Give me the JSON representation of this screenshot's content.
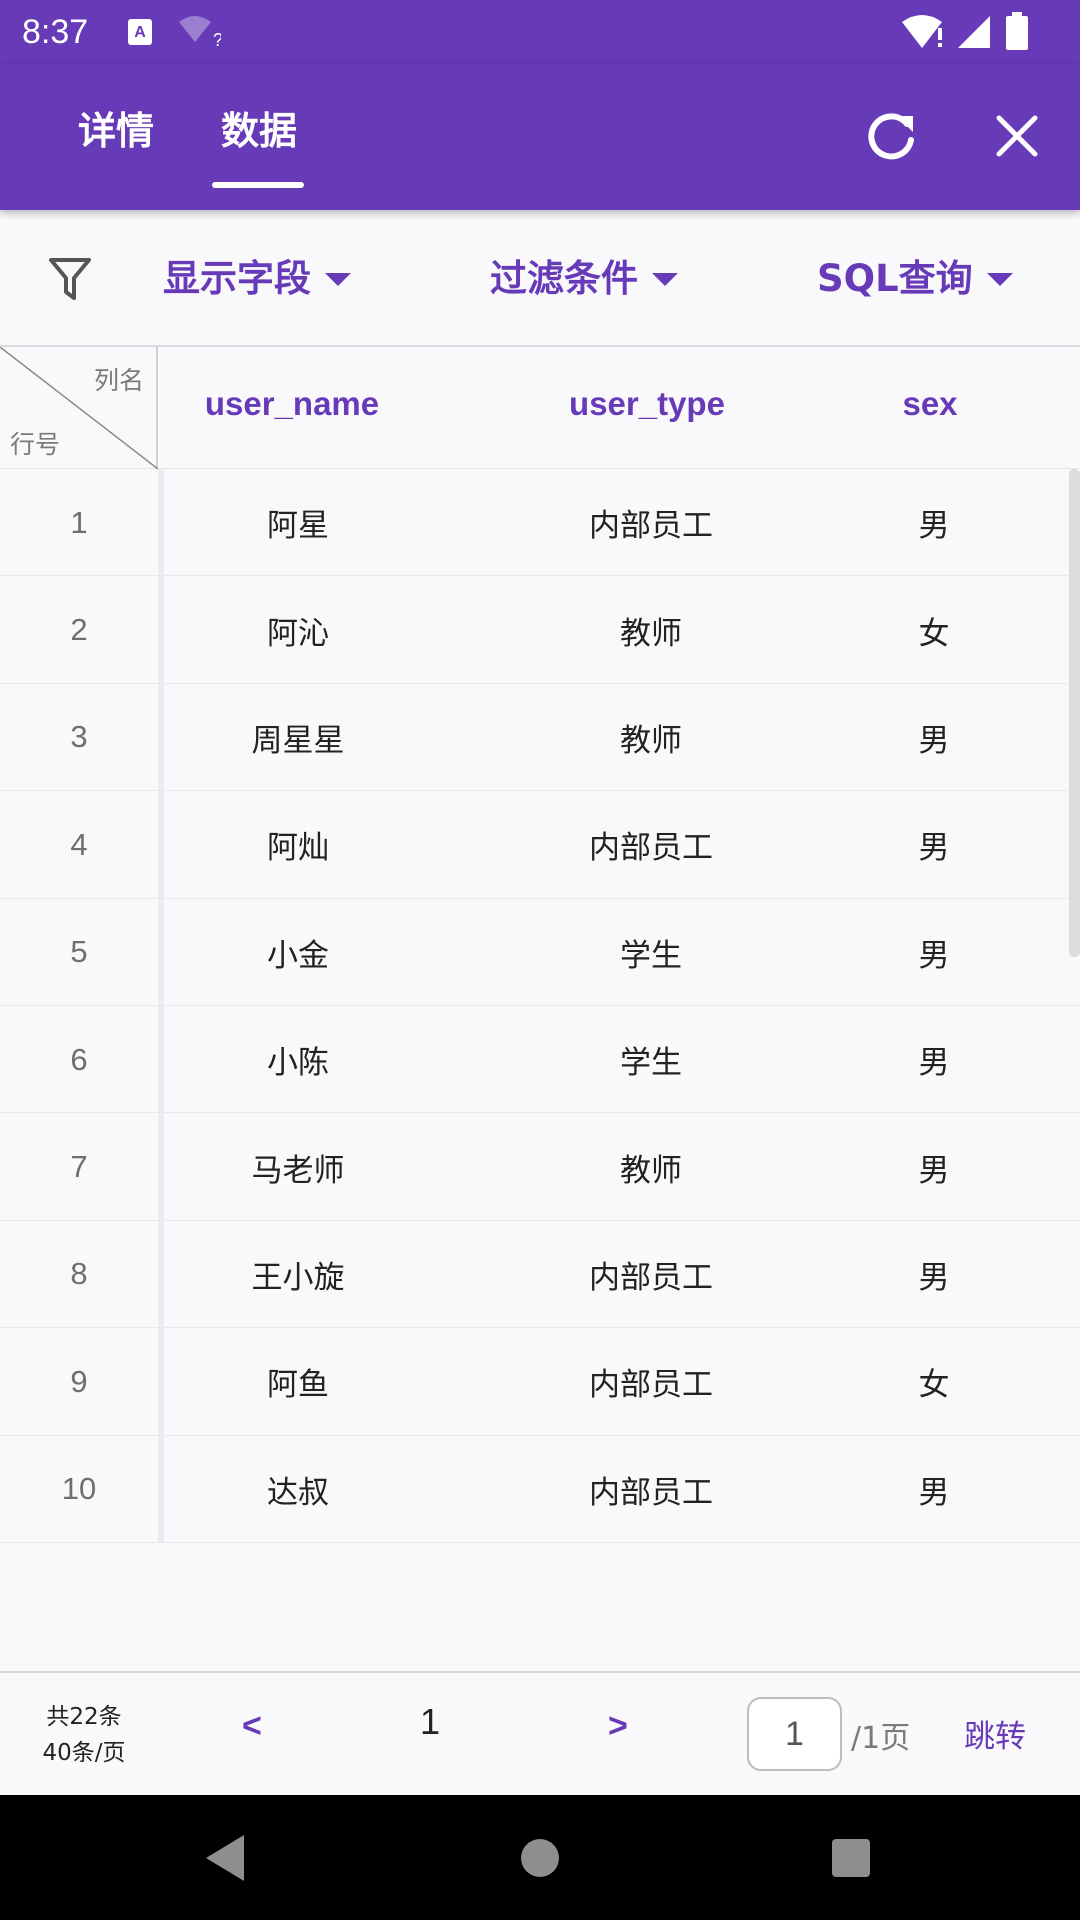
{
  "status_bar": {
    "time": "8:37",
    "icons": [
      "text-a-icon",
      "wifi-question-icon",
      "wifi-alert-icon",
      "signal-icon",
      "battery-icon"
    ]
  },
  "app_bar": {
    "tabs": [
      {
        "label": "详情",
        "selected": false
      },
      {
        "label": "数据",
        "selected": true
      }
    ],
    "actions": [
      "refresh-icon",
      "close-icon"
    ],
    "color": "#673ab7"
  },
  "toolbar": {
    "icon": "filter-icon",
    "fields_label": "显示字段",
    "filter_label": "过滤条件",
    "sql_label": "SQL查询"
  },
  "table": {
    "corner_col_label": "列名",
    "corner_row_label": "行号",
    "columns": [
      "user_name",
      "user_type",
      "sex"
    ],
    "rows": [
      {
        "idx": "1",
        "user_name": "阿星",
        "user_type": "内部员工",
        "sex": "男"
      },
      {
        "idx": "2",
        "user_name": "阿沁",
        "user_type": "教师",
        "sex": "女"
      },
      {
        "idx": "3",
        "user_name": "周星星",
        "user_type": "教师",
        "sex": "男"
      },
      {
        "idx": "4",
        "user_name": "阿灿",
        "user_type": "内部员工",
        "sex": "男"
      },
      {
        "idx": "5",
        "user_name": "小金",
        "user_type": "学生",
        "sex": "男"
      },
      {
        "idx": "6",
        "user_name": "小陈",
        "user_type": "学生",
        "sex": "男"
      },
      {
        "idx": "7",
        "user_name": "马老师",
        "user_type": "教师",
        "sex": "男"
      },
      {
        "idx": "8",
        "user_name": "王小旋",
        "user_type": "内部员工",
        "sex": "男"
      },
      {
        "idx": "9",
        "user_name": "阿鱼",
        "user_type": "内部员工",
        "sex": "女"
      },
      {
        "idx": "10",
        "user_name": "达叔",
        "user_type": "内部员工",
        "sex": "男"
      }
    ]
  },
  "pagination": {
    "total_label": "共22条",
    "per_page_label": "40条/页",
    "prev_label": "<",
    "next_label": ">",
    "current_page": "1",
    "input_value": "1",
    "total_pages_label": "/1页",
    "jump_label": "跳转"
  },
  "nav_bar": {
    "buttons": [
      "back-icon",
      "home-icon",
      "recents-icon"
    ]
  }
}
